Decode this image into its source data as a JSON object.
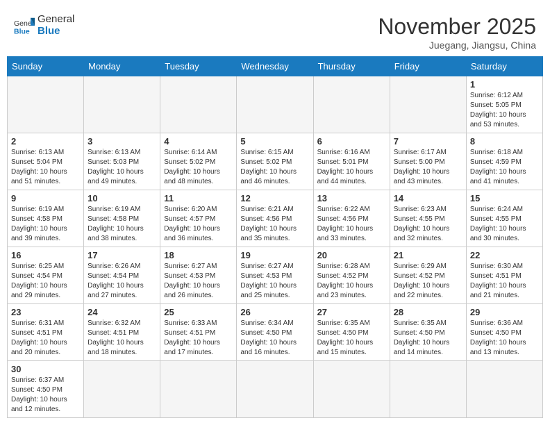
{
  "header": {
    "logo_general": "General",
    "logo_blue": "Blue",
    "month_title": "November 2025",
    "location": "Juegang, Jiangsu, China"
  },
  "days_of_week": [
    "Sunday",
    "Monday",
    "Tuesday",
    "Wednesday",
    "Thursday",
    "Friday",
    "Saturday"
  ],
  "weeks": [
    [
      {
        "day": "",
        "info": ""
      },
      {
        "day": "",
        "info": ""
      },
      {
        "day": "",
        "info": ""
      },
      {
        "day": "",
        "info": ""
      },
      {
        "day": "",
        "info": ""
      },
      {
        "day": "",
        "info": ""
      },
      {
        "day": "1",
        "info": "Sunrise: 6:12 AM\nSunset: 5:05 PM\nDaylight: 10 hours and 53 minutes."
      }
    ],
    [
      {
        "day": "2",
        "info": "Sunrise: 6:13 AM\nSunset: 5:04 PM\nDaylight: 10 hours and 51 minutes."
      },
      {
        "day": "3",
        "info": "Sunrise: 6:13 AM\nSunset: 5:03 PM\nDaylight: 10 hours and 49 minutes."
      },
      {
        "day": "4",
        "info": "Sunrise: 6:14 AM\nSunset: 5:02 PM\nDaylight: 10 hours and 48 minutes."
      },
      {
        "day": "5",
        "info": "Sunrise: 6:15 AM\nSunset: 5:02 PM\nDaylight: 10 hours and 46 minutes."
      },
      {
        "day": "6",
        "info": "Sunrise: 6:16 AM\nSunset: 5:01 PM\nDaylight: 10 hours and 44 minutes."
      },
      {
        "day": "7",
        "info": "Sunrise: 6:17 AM\nSunset: 5:00 PM\nDaylight: 10 hours and 43 minutes."
      },
      {
        "day": "8",
        "info": "Sunrise: 6:18 AM\nSunset: 4:59 PM\nDaylight: 10 hours and 41 minutes."
      }
    ],
    [
      {
        "day": "9",
        "info": "Sunrise: 6:19 AM\nSunset: 4:58 PM\nDaylight: 10 hours and 39 minutes."
      },
      {
        "day": "10",
        "info": "Sunrise: 6:19 AM\nSunset: 4:58 PM\nDaylight: 10 hours and 38 minutes."
      },
      {
        "day": "11",
        "info": "Sunrise: 6:20 AM\nSunset: 4:57 PM\nDaylight: 10 hours and 36 minutes."
      },
      {
        "day": "12",
        "info": "Sunrise: 6:21 AM\nSunset: 4:56 PM\nDaylight: 10 hours and 35 minutes."
      },
      {
        "day": "13",
        "info": "Sunrise: 6:22 AM\nSunset: 4:56 PM\nDaylight: 10 hours and 33 minutes."
      },
      {
        "day": "14",
        "info": "Sunrise: 6:23 AM\nSunset: 4:55 PM\nDaylight: 10 hours and 32 minutes."
      },
      {
        "day": "15",
        "info": "Sunrise: 6:24 AM\nSunset: 4:55 PM\nDaylight: 10 hours and 30 minutes."
      }
    ],
    [
      {
        "day": "16",
        "info": "Sunrise: 6:25 AM\nSunset: 4:54 PM\nDaylight: 10 hours and 29 minutes."
      },
      {
        "day": "17",
        "info": "Sunrise: 6:26 AM\nSunset: 4:54 PM\nDaylight: 10 hours and 27 minutes."
      },
      {
        "day": "18",
        "info": "Sunrise: 6:27 AM\nSunset: 4:53 PM\nDaylight: 10 hours and 26 minutes."
      },
      {
        "day": "19",
        "info": "Sunrise: 6:27 AM\nSunset: 4:53 PM\nDaylight: 10 hours and 25 minutes."
      },
      {
        "day": "20",
        "info": "Sunrise: 6:28 AM\nSunset: 4:52 PM\nDaylight: 10 hours and 23 minutes."
      },
      {
        "day": "21",
        "info": "Sunrise: 6:29 AM\nSunset: 4:52 PM\nDaylight: 10 hours and 22 minutes."
      },
      {
        "day": "22",
        "info": "Sunrise: 6:30 AM\nSunset: 4:51 PM\nDaylight: 10 hours and 21 minutes."
      }
    ],
    [
      {
        "day": "23",
        "info": "Sunrise: 6:31 AM\nSunset: 4:51 PM\nDaylight: 10 hours and 20 minutes."
      },
      {
        "day": "24",
        "info": "Sunrise: 6:32 AM\nSunset: 4:51 PM\nDaylight: 10 hours and 18 minutes."
      },
      {
        "day": "25",
        "info": "Sunrise: 6:33 AM\nSunset: 4:51 PM\nDaylight: 10 hours and 17 minutes."
      },
      {
        "day": "26",
        "info": "Sunrise: 6:34 AM\nSunset: 4:50 PM\nDaylight: 10 hours and 16 minutes."
      },
      {
        "day": "27",
        "info": "Sunrise: 6:35 AM\nSunset: 4:50 PM\nDaylight: 10 hours and 15 minutes."
      },
      {
        "day": "28",
        "info": "Sunrise: 6:35 AM\nSunset: 4:50 PM\nDaylight: 10 hours and 14 minutes."
      },
      {
        "day": "29",
        "info": "Sunrise: 6:36 AM\nSunset: 4:50 PM\nDaylight: 10 hours and 13 minutes."
      }
    ],
    [
      {
        "day": "30",
        "info": "Sunrise: 6:37 AM\nSunset: 4:50 PM\nDaylight: 10 hours and 12 minutes."
      },
      {
        "day": "",
        "info": ""
      },
      {
        "day": "",
        "info": ""
      },
      {
        "day": "",
        "info": ""
      },
      {
        "day": "",
        "info": ""
      },
      {
        "day": "",
        "info": ""
      },
      {
        "day": "",
        "info": ""
      }
    ]
  ]
}
